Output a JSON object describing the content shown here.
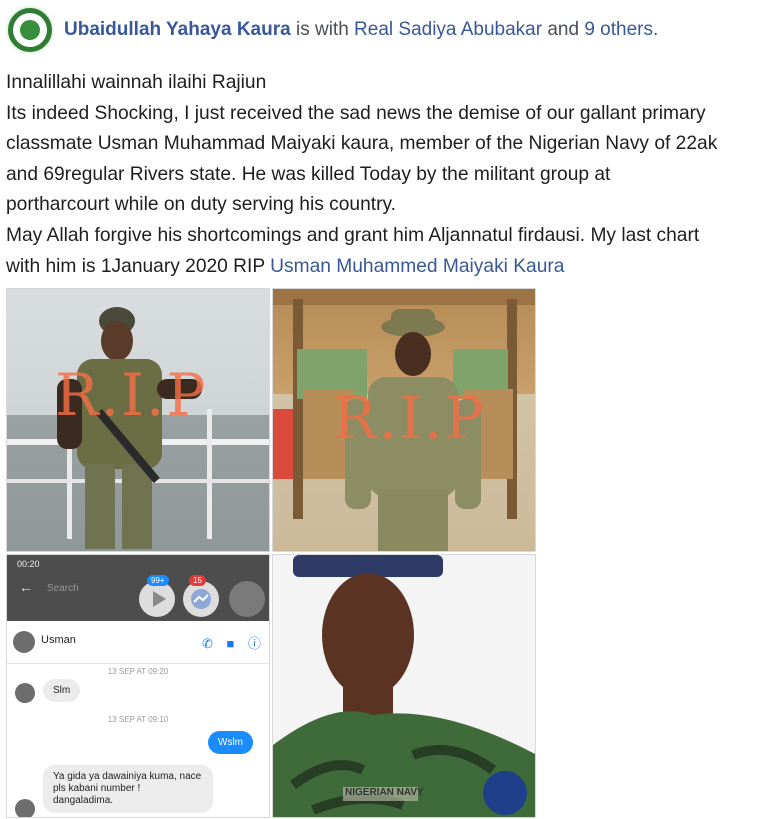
{
  "post": {
    "author": "Ubaidullah Yahaya Kaura",
    "with_text": " is with ",
    "tagged": "Real Sadiya Abubakar",
    "and_text": " and ",
    "others": "9 others",
    "period": ".",
    "lines": [
      "Innalillahi wainnah ilaihi Rajiun",
      "Its indeed Shocking, I just received the sad news the demise of our gallant primary",
      "classmate Usman Muhammad Maiyaki kaura, member of the Nigerian Navy of 22ak",
      "and 69regular Rivers state. He was killed Today by the militant group at",
      "portharcourt while on duty serving his country.",
      "May Allah forgive his shortcomings and grant him Aljannatul firdausi. My last chart"
    ],
    "last_line_text": "with him is 1January 2020 RIP ",
    "last_line_link": "Usman Muhammed Maiyaki Kaura"
  },
  "photos": {
    "rip_1": "R.I.P",
    "rip_2": "R.I.P"
  },
  "chat": {
    "status_time": "00:20",
    "search_placeholder": "Search",
    "badge_1": "99+",
    "badge_2": "15",
    "contact_name": "Usman",
    "timestamp_1": "13 SEP AT 09:20",
    "msg_in_1": "Slm",
    "timestamp_2": "13 SEP AT 09:10",
    "msg_out_1": "Wslm",
    "msg_in_2_line1": "Ya gida ya dawainiya kuma, nace",
    "msg_in_2_line2": "pls kabani number !",
    "msg_in_2_line3": "dangaladima."
  },
  "uniform": {
    "patch_text": "NIGERIAN NAVY"
  },
  "colors": {
    "link": "#385898",
    "rip": "#f46e46",
    "messenger_blue": "#1a8cff"
  }
}
